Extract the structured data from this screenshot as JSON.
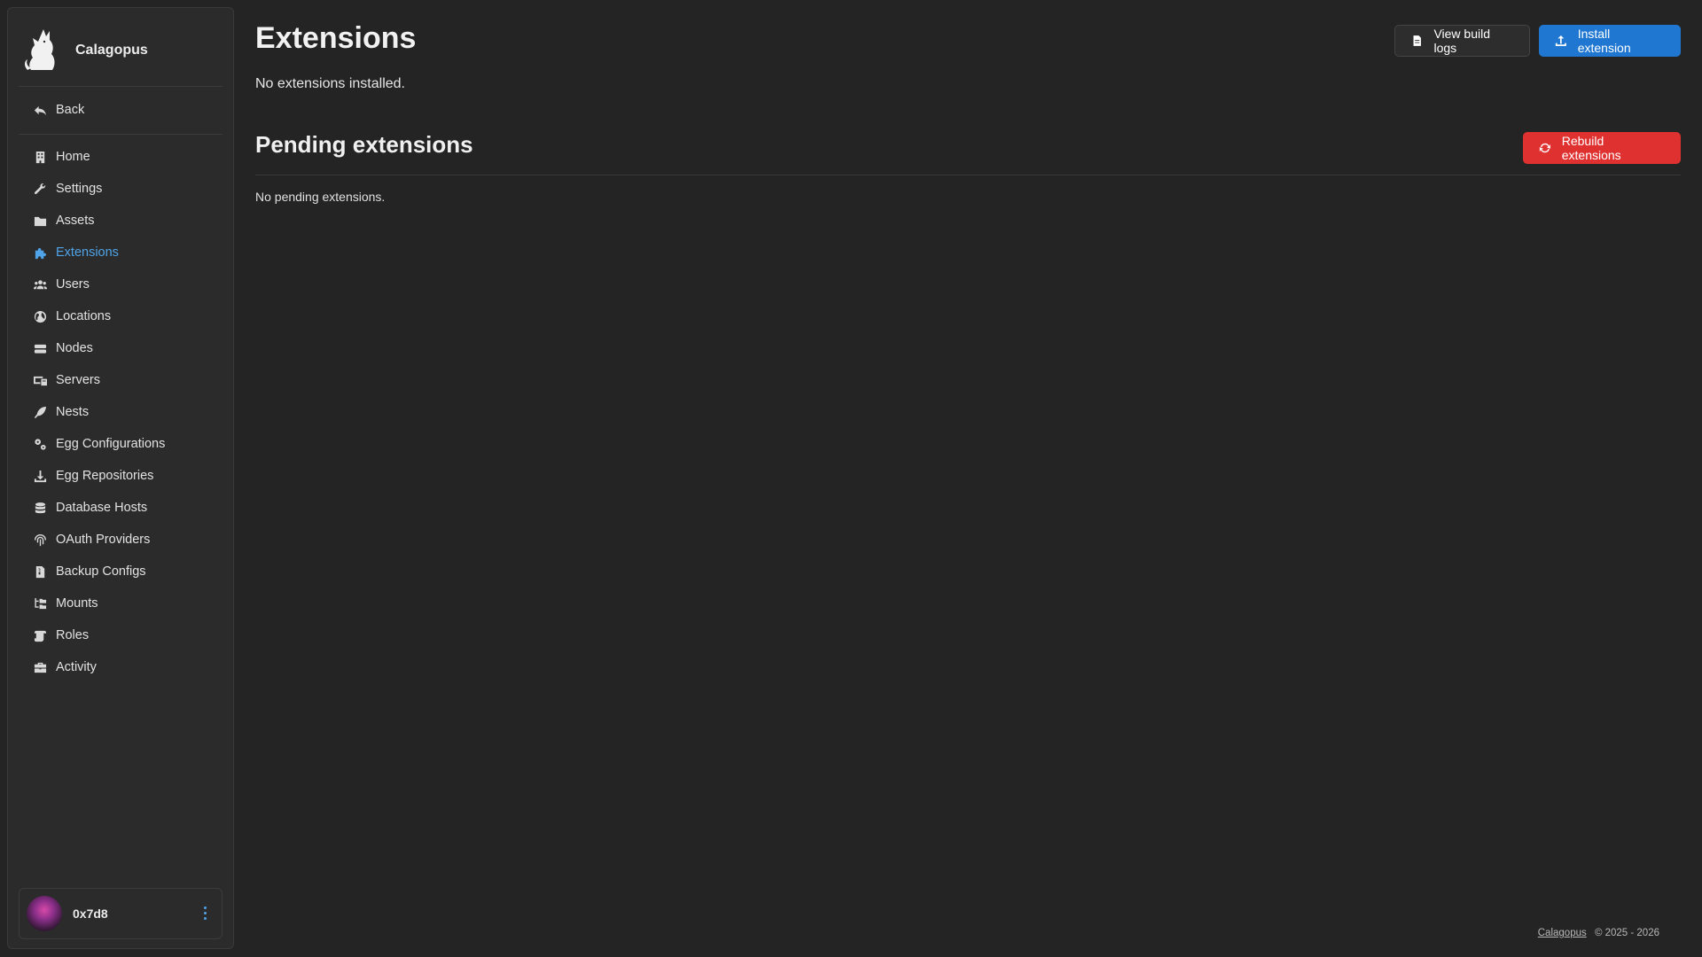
{
  "brand": {
    "name": "Calagopus"
  },
  "sidebar": {
    "back_label": "Back",
    "items": [
      {
        "label": "Home",
        "icon": "building-icon",
        "active": false
      },
      {
        "label": "Settings",
        "icon": "wrench-icon",
        "active": false
      },
      {
        "label": "Assets",
        "icon": "folder-icon",
        "active": false
      },
      {
        "label": "Extensions",
        "icon": "puzzle-icon",
        "active": true
      },
      {
        "label": "Users",
        "icon": "users-icon",
        "active": false
      },
      {
        "label": "Locations",
        "icon": "globe-icon",
        "active": false
      },
      {
        "label": "Nodes",
        "icon": "server-icon",
        "active": false
      },
      {
        "label": "Servers",
        "icon": "computer-icon",
        "active": false
      },
      {
        "label": "Nests",
        "icon": "feather-icon",
        "active": false
      },
      {
        "label": "Egg Configurations",
        "icon": "gears-icon",
        "active": false
      },
      {
        "label": "Egg Repositories",
        "icon": "download-icon",
        "active": false
      },
      {
        "label": "Database Hosts",
        "icon": "database-icon",
        "active": false
      },
      {
        "label": "OAuth Providers",
        "icon": "fingerprint-icon",
        "active": false
      },
      {
        "label": "Backup Configs",
        "icon": "file-archive-icon",
        "active": false
      },
      {
        "label": "Mounts",
        "icon": "folder-tree-icon",
        "active": false
      },
      {
        "label": "Roles",
        "icon": "scroll-icon",
        "active": false
      },
      {
        "label": "Activity",
        "icon": "briefcase-icon",
        "active": false
      }
    ]
  },
  "user": {
    "name": "0x7d8"
  },
  "header": {
    "title": "Extensions",
    "subtitle": "No extensions installed.",
    "view_logs_label": "View build logs",
    "install_label": "Install extension"
  },
  "pending": {
    "title": "Pending extensions",
    "rebuild_label": "Rebuild extensions",
    "empty_text": "No pending extensions."
  },
  "footer": {
    "link": "Calagopus",
    "copyright": "© 2025 - 2026"
  },
  "colors": {
    "accent": "#4fa3e8",
    "primary": "#1f77d1",
    "danger": "#e03131",
    "background": "#242424"
  }
}
